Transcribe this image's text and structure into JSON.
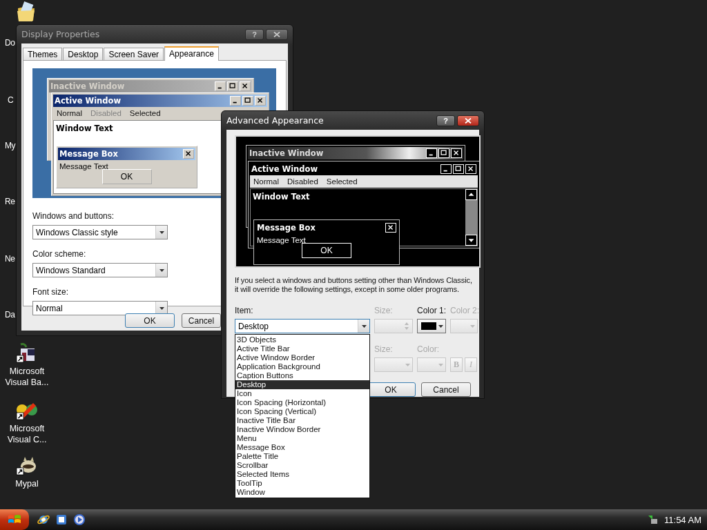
{
  "desktop": {
    "icon_labels": [
      "Do",
      "C",
      "My",
      "Re",
      "Ne",
      "Da"
    ],
    "shortcuts": [
      {
        "kind": "vb",
        "label": "Microsoft Visual Ba..."
      },
      {
        "kind": "vc",
        "label": "Microsoft Visual C..."
      },
      {
        "kind": "mypal",
        "label": "Mypal"
      }
    ]
  },
  "display_properties": {
    "title": "Display Properties",
    "help_button": "?",
    "tabs": [
      {
        "label": "Themes",
        "selected": false
      },
      {
        "label": "Desktop",
        "selected": false
      },
      {
        "label": "Screen Saver",
        "selected": false
      },
      {
        "label": "Appearance",
        "selected": true
      }
    ],
    "preview": {
      "kind": "classic",
      "inactive_title": "Inactive Window",
      "active_title": "Active Window",
      "menu": [
        {
          "label": "Normal",
          "disabled": false
        },
        {
          "label": "Disabled",
          "disabled": true
        },
        {
          "label": "Selected",
          "disabled": false
        }
      ],
      "window_text": "Window Text",
      "message_title": "Message Box",
      "message_text": "Message Text",
      "ok": "OK"
    },
    "fields": [
      {
        "label": "Windows and buttons:",
        "value": "Windows Classic style"
      },
      {
        "label": "Color scheme:",
        "value": "Windows Standard"
      },
      {
        "label": "Font size:",
        "value": "Normal"
      }
    ],
    "buttons": [
      "OK",
      "Cancel"
    ]
  },
  "advanced_appearance": {
    "title": "Advanced Appearance",
    "help_button": "?",
    "preview": {
      "kind": "black",
      "inactive_title": "Inactive Window",
      "active_title": "Active Window",
      "menu": [
        {
          "label": "Normal"
        },
        {
          "label": "Disabled"
        },
        {
          "label": "Selected"
        }
      ],
      "window_text": "Window Text",
      "message_title": "Message Box",
      "message_text": "Message Text",
      "ok": "OK"
    },
    "note": "If you select a windows and buttons setting other than Windows Classic, it will override the following settings, except in some older programs.",
    "item": {
      "label": "Item:",
      "value": "Desktop",
      "expanded": true,
      "options": [
        {
          "label": "3D Objects",
          "selected": false
        },
        {
          "label": "Active Title Bar",
          "selected": false
        },
        {
          "label": "Active Window Border",
          "selected": false
        },
        {
          "label": "Application Background",
          "selected": false
        },
        {
          "label": "Caption Buttons",
          "selected": false
        },
        {
          "label": "Desktop",
          "selected": true
        },
        {
          "label": "Icon",
          "selected": false
        },
        {
          "label": "Icon Spacing (Horizontal)",
          "selected": false
        },
        {
          "label": "Icon Spacing (Vertical)",
          "selected": false
        },
        {
          "label": "Inactive Title Bar",
          "selected": false
        },
        {
          "label": "Inactive Window Border",
          "selected": false
        },
        {
          "label": "Menu",
          "selected": false
        },
        {
          "label": "Message Box",
          "selected": false
        },
        {
          "label": "Palette Title",
          "selected": false
        },
        {
          "label": "Scrollbar",
          "selected": false
        },
        {
          "label": "Selected Items",
          "selected": false
        },
        {
          "label": "ToolTip",
          "selected": false
        },
        {
          "label": "Window",
          "selected": false
        }
      ]
    },
    "size": {
      "label": "Size:",
      "disabled": true
    },
    "color1": {
      "label": "Color 1:",
      "disabled": false
    },
    "color2": {
      "label": "Color 2:",
      "disabled": true
    },
    "font_size": {
      "label": "Size:",
      "disabled": true
    },
    "font_color": {
      "label": "Color:",
      "disabled": true
    },
    "bold": {
      "label": "B",
      "disabled": true
    },
    "italic": {
      "label": "I",
      "disabled": true
    },
    "buttons": [
      "OK",
      "Cancel"
    ]
  },
  "taskbar": {
    "clock": "11:54 AM"
  }
}
